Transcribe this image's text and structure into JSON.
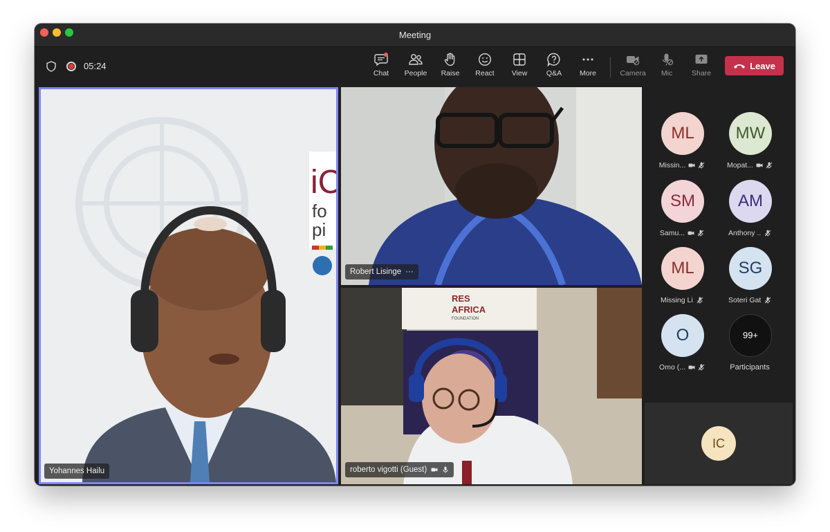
{
  "window": {
    "title": "Meeting"
  },
  "toolbar": {
    "timer": "05:24",
    "buttons": [
      {
        "id": "chat",
        "label": "Chat",
        "icon": "chat-icon"
      },
      {
        "id": "people",
        "label": "People",
        "icon": "people-icon"
      },
      {
        "id": "raise",
        "label": "Raise",
        "icon": "hand-icon"
      },
      {
        "id": "react",
        "label": "React",
        "icon": "smiley-icon"
      },
      {
        "id": "view",
        "label": "View",
        "icon": "grid-icon"
      },
      {
        "id": "qa",
        "label": "Q&A",
        "icon": "question-bubble-icon"
      },
      {
        "id": "more",
        "label": "More",
        "icon": "ellipsis-icon"
      },
      {
        "id": "camera",
        "label": "Camera",
        "icon": "camera-off-icon"
      },
      {
        "id": "mic",
        "label": "Mic",
        "icon": "mic-off-icon"
      },
      {
        "id": "share",
        "label": "Share",
        "icon": "share-icon"
      }
    ],
    "leave_label": "Leave",
    "colors": {
      "leave": "#c4314b",
      "active_speaker_border": "#7f85f5"
    }
  },
  "videos": {
    "main": {
      "name": "Yohannes Hailu"
    },
    "top_right": {
      "name": "Robert Lisinge",
      "menu": "···"
    },
    "bottom_right": {
      "name": "roberto vigotti (Guest)"
    },
    "banner_text": [
      "RES",
      "AFRICA",
      "FOUNDATION"
    ]
  },
  "roster": [
    {
      "initials": "ML",
      "name": "Missin...",
      "bg": "#f3d4cf",
      "fg": "#8b2f2a",
      "camera_off": true,
      "mic_off": false
    },
    {
      "initials": "MW",
      "name": "Mopat...",
      "bg": "#dde8d2",
      "fg": "#3e5b2a",
      "camera_off": true,
      "mic_off": false
    },
    {
      "initials": "SM",
      "name": "Samu...",
      "bg": "#f3d4d7",
      "fg": "#8b2a3a",
      "camera_off": true,
      "mic_off": false
    },
    {
      "initials": "AM",
      "name": "Anthony ...",
      "bg": "#dcd8ef",
      "fg": "#3a2f7a",
      "camera_off": false,
      "mic_off": true
    },
    {
      "initials": "ML",
      "name": "Missing Li...",
      "bg": "#f3d4cf",
      "fg": "#8b2f2a",
      "camera_off": false,
      "mic_off": true
    },
    {
      "initials": "SG",
      "name": "Soteri Gat...",
      "bg": "#d5e2f0",
      "fg": "#1f3f66",
      "camera_off": false,
      "mic_off": true
    },
    {
      "initials": "O",
      "name": "Omo (...",
      "bg": "#d5e2f0",
      "fg": "#1f3f66",
      "camera_off": true,
      "mic_off": false
    }
  ],
  "participants_more": {
    "count": "99+",
    "label": "Participants"
  },
  "self": {
    "initials": "IC"
  }
}
